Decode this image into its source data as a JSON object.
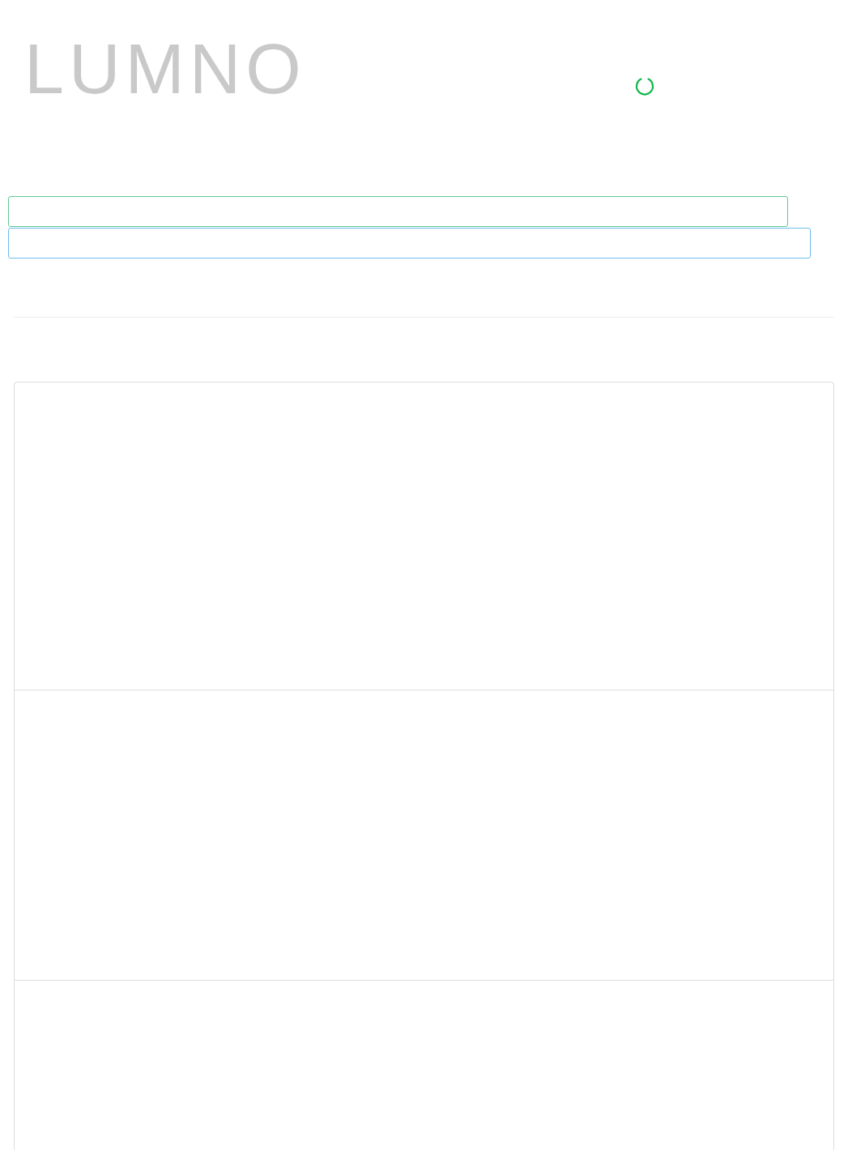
{
  "logo": {
    "text": "LUMNO"
  },
  "loading": true,
  "alerts": [
    {
      "kind": "success"
    },
    {
      "kind": "info"
    }
  ],
  "panel_sections": [
    {
      "kind": "blank"
    },
    {
      "kind": "blank"
    },
    {
      "kind": "blank"
    }
  ]
}
